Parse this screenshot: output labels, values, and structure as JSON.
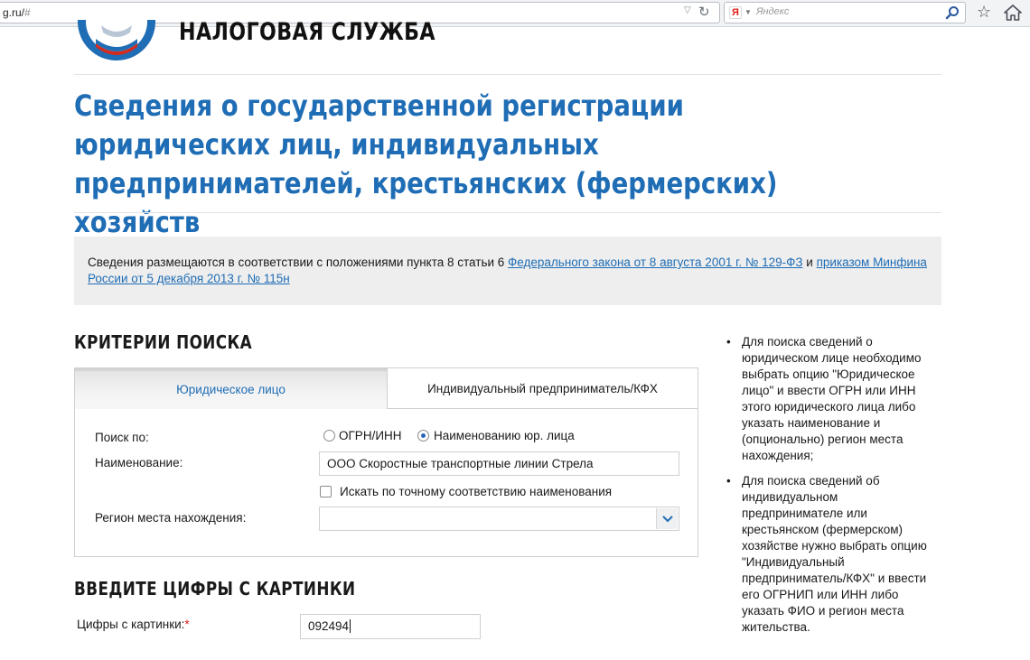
{
  "browser": {
    "url_host": "g.ru/",
    "url_path": "#",
    "search_engine_logo": "Я",
    "search_placeholder": "Яндекс",
    "icons": [
      "dropdown-arrow-icon",
      "reload-icon",
      "search-icon",
      "bookmark-star-icon",
      "home-icon"
    ]
  },
  "header": {
    "logo_text": "НАЛОГОВАЯ СЛУЖБА",
    "title": "Сведения о государственной регистрации юридических лиц, индивидуальных предпринимателей, крестьянских (фермерских) хозяйств"
  },
  "notice": {
    "text_before": "Сведения размещаются в соответствии с положениями пункта 8 статьи 6 ",
    "link1": "Федерального закона от 8 августа 2001 г. № 129-ФЗ",
    "text_mid": " и ",
    "link2": "приказом Минфина России от 5 декабря 2013 г. № 115н"
  },
  "search": {
    "heading": "КРИТЕРИИ ПОИСКА",
    "tabs": [
      {
        "label": "Юридическое лицо",
        "active": true
      },
      {
        "label": "Индивидуальный предприниматель/КФХ",
        "active": false
      }
    ],
    "search_by_label": "Поиск по:",
    "radio_ogrn": "ОГРН/ИНН",
    "radio_name": "Наименованию юр. лица",
    "radio_selected": "name",
    "name_label": "Наименование:",
    "name_value": "ООО Скоростные транспортные линии Стрела",
    "exact_match_label": "Искать по точному соответствию наименования",
    "exact_match_checked": false,
    "region_label": "Регион места нахождения:",
    "region_value": ""
  },
  "captcha": {
    "heading": "ВВЕДИТЕ ЦИФРЫ С КАРТИНКИ",
    "label": "Цифры с картинки:",
    "required_mark": "*",
    "value": "092494"
  },
  "help": {
    "items": [
      "Для поиска сведений о юридическом лице необходимо выбрать опцию \"Юридическое лицо\" и ввести ОГРН или ИНН этого юридического лица либо указать наименование и (опционально) регион места нахождения;",
      "Для поиска сведений об индивидуальном предпринимателе или крестьянском (фермерском) хозяйстве нужно выбрать опцию \"Индивидуальный предприниматель/КФХ\" и ввести его ОГРНИП или ИНН либо указать ФИО и регион места жительства."
    ]
  },
  "colors": {
    "brand_blue": "#1f6db5",
    "radio_blue": "#2a66b8",
    "required_red": "#d4201c",
    "notice_bg": "#eeeeee"
  }
}
